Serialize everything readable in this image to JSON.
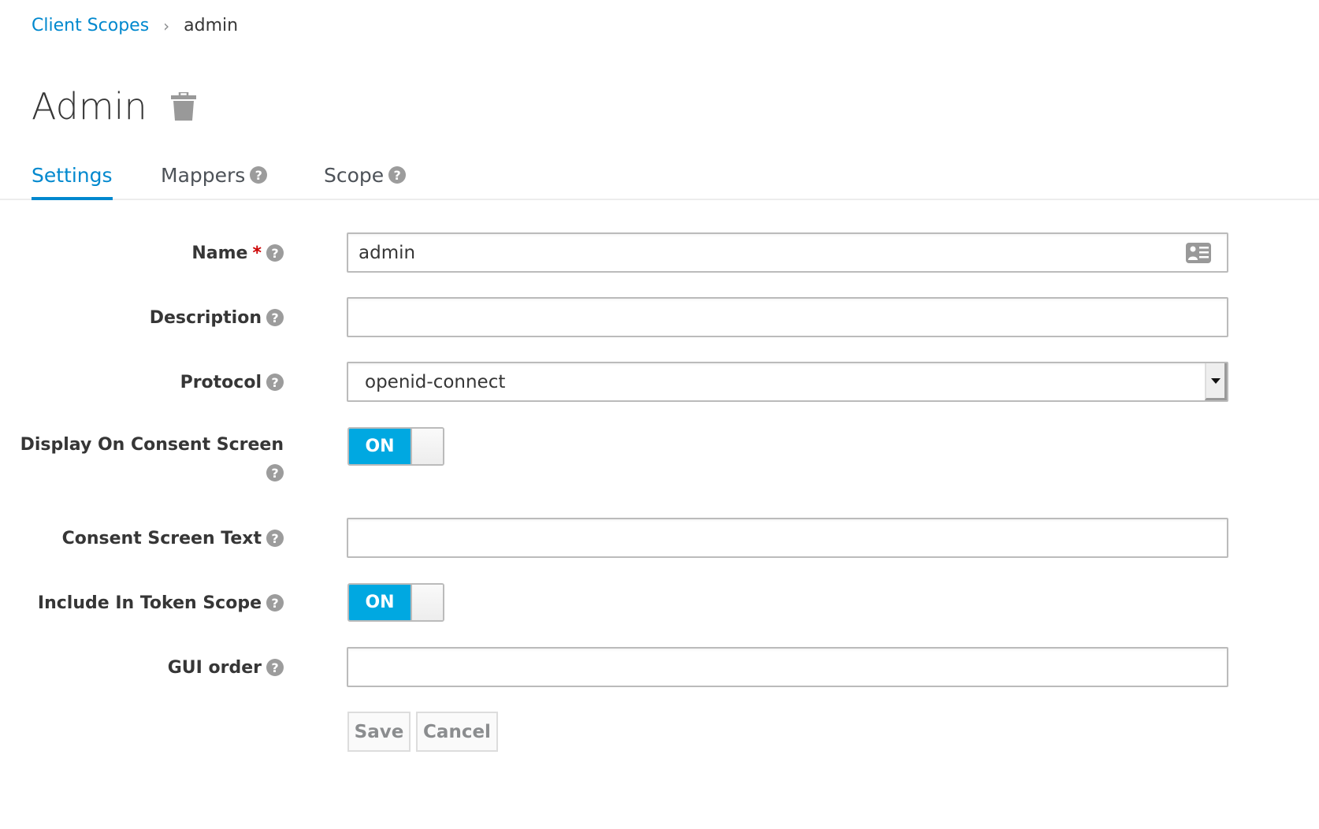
{
  "breadcrumb": {
    "parent": "Client Scopes",
    "separator": "›",
    "current": "admin"
  },
  "page": {
    "title": "Admin"
  },
  "tabs": [
    {
      "label": "Settings",
      "active": true
    },
    {
      "label": "Mappers",
      "help": true
    },
    {
      "label": "Scope",
      "help": true
    }
  ],
  "form": {
    "name": {
      "label": "Name",
      "required_mark": "*",
      "value": "admin"
    },
    "description": {
      "label": "Description",
      "value": ""
    },
    "protocol": {
      "label": "Protocol",
      "value": "openid-connect"
    },
    "display_on_consent": {
      "label": "Display On Consent Screen",
      "state": "ON"
    },
    "consent_text": {
      "label": "Consent Screen Text",
      "value": ""
    },
    "include_in_token_scope": {
      "label": "Include In Token Scope",
      "state": "ON"
    },
    "gui_order": {
      "label": "GUI order",
      "value": ""
    }
  },
  "actions": {
    "save": "Save",
    "cancel": "Cancel"
  },
  "help_glyph": "?",
  "colors": {
    "accent": "#0088ce",
    "toggle_on": "#00a8e1",
    "required": "#cc0000"
  }
}
